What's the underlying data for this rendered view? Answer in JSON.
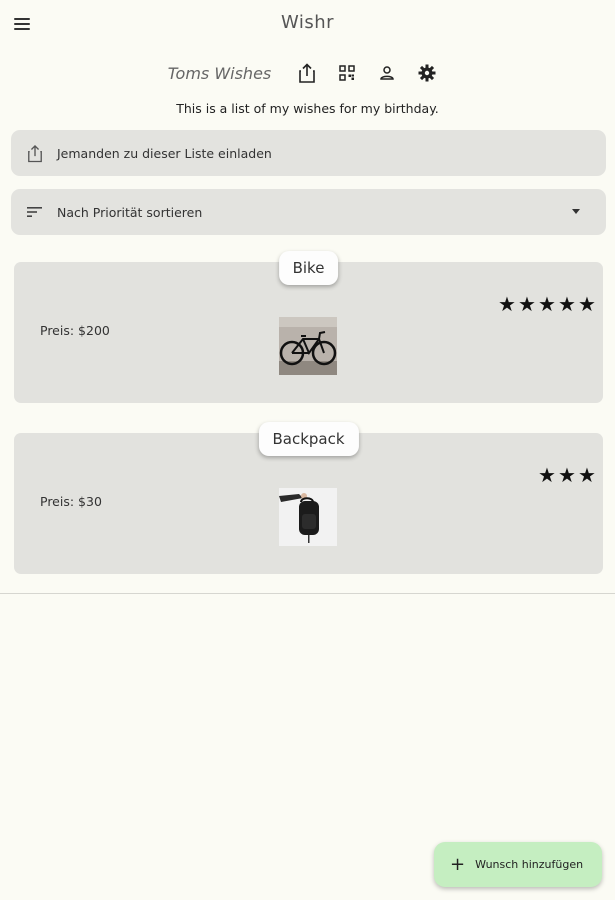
{
  "app": {
    "title": "Wishr"
  },
  "list": {
    "title": "Toms Wishes",
    "description": "This is a list of my wishes for my birthday.",
    "header_icons": [
      "share-icon",
      "qr-code-icon",
      "person-icon",
      "settings-icon"
    ]
  },
  "invite": {
    "label": "Jemanden zu dieser Liste einladen",
    "icon": "share-icon"
  },
  "sort": {
    "label": "Nach Priorität sortieren",
    "icon": "sort-icon"
  },
  "wishes": [
    {
      "name": "Bike",
      "price": "Preis: $200",
      "stars": 5,
      "image": "bike-image"
    },
    {
      "name": "Backpack",
      "price": "Preis: $30",
      "stars": 3,
      "image": "backpack-image"
    }
  ],
  "fab": {
    "label": "Wunsch hinzufügen",
    "icon": "plus-icon"
  },
  "colors": {
    "background": "#fbfbf4",
    "card": "#e2e2de",
    "fab": "#c5eec1"
  }
}
